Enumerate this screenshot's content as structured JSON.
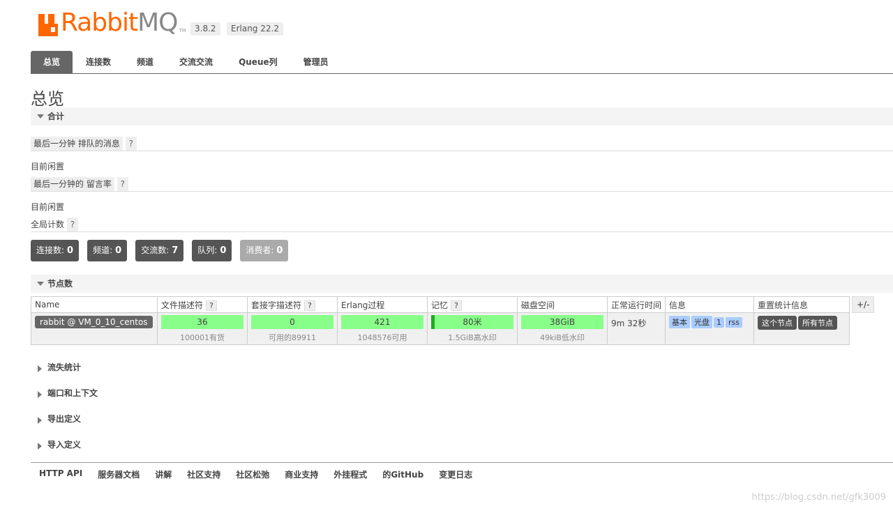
{
  "header": {
    "logo_text_rabbit": "Rabbit",
    "logo_text_mq": "MQ",
    "logo_tm": "TM",
    "version": "3.8.2",
    "erlang": "Erlang 22.2"
  },
  "tabs": [
    {
      "label": "总览",
      "active": true
    },
    {
      "label": "连接数"
    },
    {
      "label": "频道"
    },
    {
      "label": "交流交流"
    },
    {
      "label": "Queue列"
    },
    {
      "label": "管理员"
    }
  ],
  "page": {
    "title": "总览",
    "totals_section": "合计",
    "queued_label": "最后一分钟 排队的消息",
    "q_mark": "?",
    "idle1": "目前闲置",
    "rates_label": "最后一分钟的 留言率",
    "idle2": "目前闲置",
    "global_counts_label": "全局计数",
    "counts": [
      {
        "label": "连接数:",
        "value": "0"
      },
      {
        "label": "频道:",
        "value": "0"
      },
      {
        "label": "交流数:",
        "value": "7"
      },
      {
        "label": "队列:",
        "value": "0"
      },
      {
        "label": "消费者:",
        "value": "0"
      }
    ],
    "nodes_section": "节点数"
  },
  "nodes_table": {
    "headers": [
      "Name",
      "文件描述符",
      "套接字描述符",
      "Erlang过程",
      "记忆",
      "磁盘空间",
      "正常运行时间",
      "信息",
      "重置统计信息"
    ],
    "plus_minus": "+/-",
    "row": {
      "name": "rabbit @ VM_0_10_centos",
      "fd": "36",
      "fd_sub": "100001有货",
      "fd_fill": 0.0004,
      "sockets": "0",
      "sockets_sub": "可用的89911",
      "sockets_fill": 0,
      "erlang": "421",
      "erlang_sub": "1048576可用",
      "erlang_fill": 0.0004,
      "memory": "80米",
      "memory_sub": "1.5GiB高水印",
      "disk": "38GiB",
      "disk_sub": "49kiB低水印",
      "uptime": "9m 32秒",
      "info_tags": [
        "基本",
        "光盘",
        "1",
        "rss"
      ],
      "reset_this": "这个节点",
      "reset_all": "所有节点"
    }
  },
  "collapsed_sections": [
    "流失统计",
    "端口和上下文",
    "导出定义",
    "导入定义"
  ],
  "footer": [
    "HTTP API",
    "服务器文档",
    "讲解",
    "社区支持",
    "社区松弛",
    "商业支持",
    "外挂程式",
    "的GitHub",
    "变更日志"
  ],
  "watermark": "https://blog.csdn.net/gfk3009",
  "colors": {
    "brand": "#ff6600",
    "bar_green": "#88ff88",
    "tab_active": "#666666",
    "tag_blue": "#aaccff"
  }
}
